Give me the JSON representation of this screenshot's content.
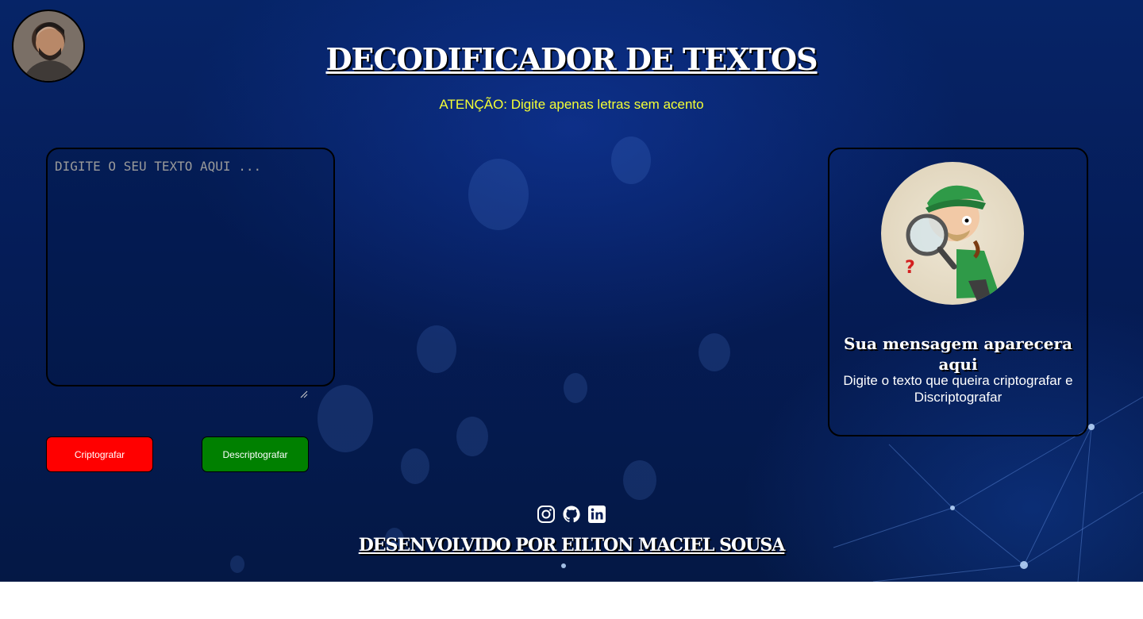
{
  "header": {
    "title": "DECODIFICADOR DE TEXTOS",
    "warning": "ATENÇÃO: Digite apenas letras sem acento"
  },
  "input": {
    "placeholder": "DIGITE O SEU TEXTO AQUI ...",
    "value": ""
  },
  "buttons": {
    "encrypt_label": "Criptografar",
    "decrypt_label": "Descriptografar"
  },
  "output": {
    "title": "Sua mensagem aparecera aqui",
    "description": "Digite o texto que queira criptografar e Discriptografar"
  },
  "footer": {
    "social_icons": [
      "instagram-icon",
      "github-icon",
      "linkedin-icon"
    ],
    "credit": "DESENVOLVIDO POR EILTON MACIEL SOUSA"
  },
  "colors": {
    "background": "#051c57",
    "warning_text": "#f4ff34",
    "encrypt_button": "#ff0000",
    "decrypt_button": "#008000",
    "text": "#ffffff"
  }
}
